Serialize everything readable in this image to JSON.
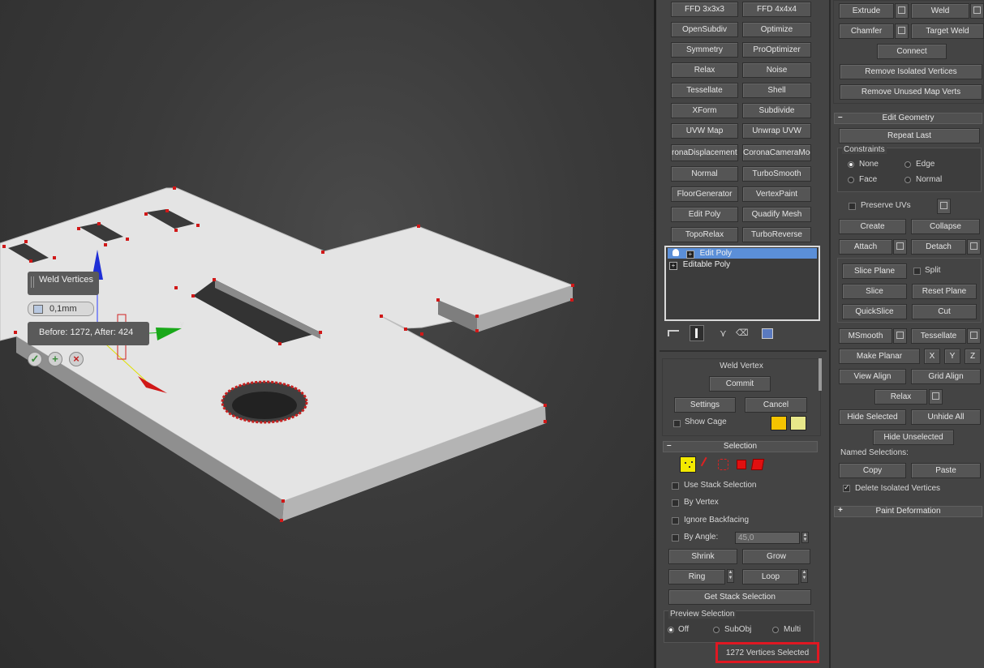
{
  "viewport": {
    "weld_caddy": {
      "title": "Weld Vertices",
      "threshold_value": "0,1mm",
      "result_text": "Before: 1272, After: 424"
    },
    "gizmo_axes": {
      "y": "y"
    }
  },
  "modifier_buttons": [
    [
      "FFD 3x3x3",
      "FFD 4x4x4"
    ],
    [
      "OpenSubdiv",
      "Optimize"
    ],
    [
      "Symmetry",
      "ProOptimizer"
    ],
    [
      "Relax",
      "Noise"
    ],
    [
      "Tessellate",
      "Shell"
    ],
    [
      "XForm",
      "Subdivide"
    ],
    [
      "UVW Map",
      "Unwrap UVW"
    ],
    [
      "ronaDisplacementM",
      "CoronaCameraMod"
    ],
    [
      "Normal",
      "TurboSmooth"
    ],
    [
      "FloorGenerator",
      "VertexPaint"
    ],
    [
      "Edit Poly",
      "Quadify Mesh"
    ],
    [
      "TopoRelax",
      "TurboReverse"
    ]
  ],
  "modifier_stack": [
    "Edit Poly",
    "Editable Poly"
  ],
  "weld_vertex": {
    "title": "Weld Vertex",
    "commit": "Commit",
    "settings": "Settings",
    "cancel": "Cancel",
    "show_cage": "Show Cage",
    "cage_colors": [
      "#f5c400",
      "#e8e88a"
    ]
  },
  "selection": {
    "title": "Selection",
    "use_stack_selection": "Use Stack Selection",
    "by_vertex": "By Vertex",
    "ignore_backfacing": "Ignore Backfacing",
    "by_angle": "By Angle:",
    "angle_value": "45,0",
    "shrink": "Shrink",
    "grow": "Grow",
    "ring": "Ring",
    "loop": "Loop",
    "get_stack_selection": "Get Stack Selection",
    "preview_selection": "Preview Selection",
    "preview_off": "Off",
    "preview_subobj": "SubObj",
    "preview_multi": "Multi",
    "status": "1272 Vertices Selected"
  },
  "edit_vertices": {
    "extrude": "Extrude",
    "weld": "Weld",
    "chamfer": "Chamfer",
    "target_weld": "Target Weld",
    "connect": "Connect",
    "remove_isolated": "Remove Isolated Vertices",
    "remove_unused": "Remove Unused Map Verts"
  },
  "edit_geometry": {
    "title": "Edit Geometry",
    "repeat_last": "Repeat Last",
    "constraints": "Constraints",
    "c_none": "None",
    "c_edge": "Edge",
    "c_face": "Face",
    "c_normal": "Normal",
    "preserve_uvs": "Preserve UVs",
    "create": "Create",
    "collapse": "Collapse",
    "attach": "Attach",
    "detach": "Detach",
    "slice_plane": "Slice Plane",
    "split": "Split",
    "slice": "Slice",
    "reset_plane": "Reset Plane",
    "quickslice": "QuickSlice",
    "cut": "Cut",
    "msmooth": "MSmooth",
    "tessellate": "Tessellate",
    "make_planar": "Make Planar",
    "x": "X",
    "y": "Y",
    "z": "Z",
    "view_align": "View Align",
    "grid_align": "Grid Align",
    "relax": "Relax",
    "hide_selected": "Hide Selected",
    "unhide_all": "Unhide All",
    "hide_unselected": "Hide Unselected",
    "named_selections": "Named Selections:",
    "copy": "Copy",
    "paste": "Paste",
    "delete_isolated": "Delete Isolated Vertices"
  },
  "paint_deformation": {
    "title": "Paint Deformation"
  }
}
